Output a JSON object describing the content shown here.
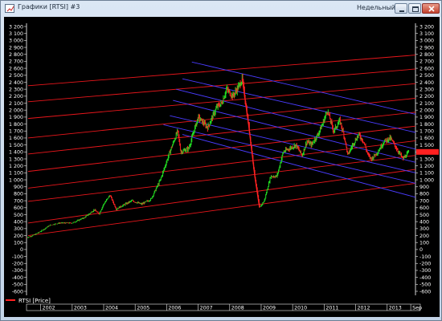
{
  "window": {
    "title": "Графики [RTSI] #3",
    "period_label": "Недельный",
    "buttons": [
      "minimize",
      "maximize",
      "close"
    ]
  },
  "legend": {
    "series_name": "RTSI [Price]",
    "color": "#ff2020"
  },
  "colors": {
    "background": "#000000",
    "axis_text": "#ffffff",
    "price_up": "#22dd22",
    "price_down": "#ff2222",
    "channel_red": "#e8161b",
    "channel_blue": "#4a3cff",
    "last_price_marker": "#ff2020"
  },
  "chart_data": {
    "type": "line",
    "title": "",
    "xlabel": "",
    "ylabel": "",
    "ylim": [
      -600,
      3200
    ],
    "y_ticks": [
      -600,
      -500,
      -400,
      -300,
      -200,
      -100,
      0,
      100,
      200,
      300,
      400,
      500,
      600,
      700,
      800,
      900,
      1000,
      1100,
      1200,
      1300,
      1400,
      1500,
      1600,
      1700,
      1800,
      1900,
      2000,
      2100,
      2200,
      2300,
      2400,
      2500,
      2600,
      2700,
      2800,
      2900,
      3000,
      3100,
      3200
    ],
    "x_axis": {
      "start_year": 2001.55,
      "end_year": 2013.9,
      "tick_labels": [
        "2002",
        "2003",
        "2004",
        "2005",
        "2006",
        "2007",
        "2008",
        "2009",
        "2010",
        "2011",
        "2012",
        "2013",
        "Sep"
      ],
      "tick_years": [
        2002,
        2003,
        2004,
        2005,
        2006,
        2007,
        2008,
        2009,
        2010,
        2011,
        2012,
        2013,
        2013.75
      ]
    },
    "series": [
      {
        "name": "RTSI [Price]",
        "x": [
          2001.55,
          2001.75,
          2002.0,
          2002.3,
          2002.6,
          2003.0,
          2003.4,
          2003.7,
          2003.85,
          2004.0,
          2004.2,
          2004.4,
          2004.6,
          2004.9,
          2005.2,
          2005.5,
          2005.8,
          2006.1,
          2006.35,
          2006.45,
          2006.7,
          2007.0,
          2007.3,
          2007.6,
          2007.75,
          2007.9,
          2008.1,
          2008.3,
          2008.4,
          2008.6,
          2008.8,
          2008.95,
          2009.1,
          2009.3,
          2009.5,
          2009.7,
          2009.9,
          2010.1,
          2010.3,
          2010.45,
          2010.6,
          2010.8,
          2010.95,
          2011.1,
          2011.3,
          2011.5,
          2011.65,
          2011.75,
          2011.9,
          2012.1,
          2012.25,
          2012.4,
          2012.5,
          2012.7,
          2012.9,
          2013.1,
          2013.3,
          2013.5,
          2013.7
        ],
        "values": [
          170,
          200,
          260,
          350,
          380,
          380,
          460,
          570,
          510,
          650,
          780,
          580,
          630,
          700,
          650,
          720,
          1000,
          1400,
          1700,
          1400,
          1450,
          1900,
          1750,
          2050,
          2100,
          2300,
          2200,
          2350,
          2450,
          1800,
          1050,
          600,
          700,
          1050,
          1050,
          1400,
          1450,
          1500,
          1350,
          1550,
          1500,
          1650,
          1800,
          2000,
          1700,
          1850,
          1600,
          1350,
          1500,
          1650,
          1550,
          1350,
          1300,
          1400,
          1550,
          1600,
          1450,
          1300,
          1400
        ]
      }
    ],
    "channels": {
      "red_lines": [
        [
          [
            2001.6,
            200
          ],
          [
            2013.9,
            950
          ]
        ],
        [
          [
            2001.6,
            380
          ],
          [
            2013.9,
            1150
          ]
        ],
        [
          [
            2001.6,
            690
          ],
          [
            2013.9,
            1350
          ]
        ],
        [
          [
            2001.6,
            880
          ],
          [
            2013.9,
            1560
          ]
        ],
        [
          [
            2001.6,
            1120
          ],
          [
            2013.9,
            1770
          ]
        ],
        [
          [
            2001.6,
            1370
          ],
          [
            2013.9,
            1970
          ]
        ],
        [
          [
            2001.6,
            1600
          ],
          [
            2013.9,
            2170
          ]
        ],
        [
          [
            2001.6,
            1880
          ],
          [
            2013.9,
            2380
          ]
        ],
        [
          [
            2001.6,
            2120
          ],
          [
            2013.9,
            2590
          ]
        ],
        [
          [
            2001.6,
            2350
          ],
          [
            2013.9,
            2790
          ]
        ]
      ],
      "blue_lines": [
        [
          [
            2006.8,
            2690
          ],
          [
            2013.9,
            1940
          ]
        ],
        [
          [
            2006.5,
            2450
          ],
          [
            2013.9,
            1680
          ]
        ],
        [
          [
            2006.3,
            2300
          ],
          [
            2013.9,
            1440
          ]
        ],
        [
          [
            2006.2,
            2140
          ],
          [
            2013.9,
            1250
          ]
        ],
        [
          [
            2006.1,
            1920
          ],
          [
            2013.9,
            1100
          ]
        ],
        [
          [
            2005.9,
            1790
          ],
          [
            2013.9,
            950
          ]
        ],
        [
          [
            2006.5,
            1650
          ],
          [
            2013.9,
            750
          ]
        ]
      ]
    },
    "grid": false,
    "legend_position": "bottom-left"
  }
}
